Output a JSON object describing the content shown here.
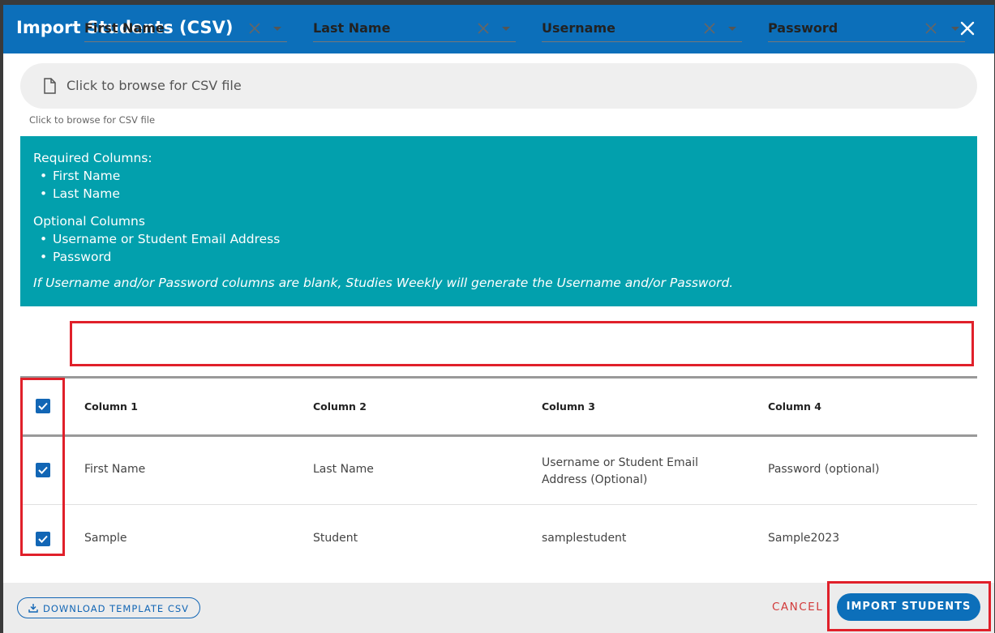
{
  "dialog": {
    "title": "Import Students (CSV)"
  },
  "file_input": {
    "placeholder": "Click to browse for CSV file",
    "hint": "Click to browse for CSV file"
  },
  "info": {
    "required_heading": "Required Columns:",
    "required_items": [
      "First Name",
      "Last Name"
    ],
    "optional_heading": "Optional Columns",
    "optional_items": [
      "Username or Student Email Address",
      "Password"
    ],
    "note": "If Username and/or Password columns are blank, Studies Weekly will generate the Username and/or Password."
  },
  "mapping": [
    {
      "label": "First Name"
    },
    {
      "label": "Last Name"
    },
    {
      "label": "Username"
    },
    {
      "label": "Password"
    }
  ],
  "table": {
    "headers": [
      "Column 1",
      "Column 2",
      "Column 3",
      "Column 4"
    ],
    "rows": [
      [
        "First Name",
        "Last Name",
        "Username or Student Email Address (Optional)",
        "Password (optional)"
      ],
      [
        "Sample",
        "Student",
        "samplestudent",
        "Sample2023"
      ]
    ],
    "row_checked": [
      true,
      true,
      true
    ]
  },
  "footer": {
    "download_label": "DOWNLOAD TEMPLATE CSV",
    "cancel_label": "CANCEL",
    "import_label": "IMPORT STUDENTS"
  },
  "colors": {
    "header_blue": "#0c6fba",
    "info_teal": "#02a0ad",
    "highlight_red": "#e0202a",
    "cancel_red": "#d23a3a"
  }
}
